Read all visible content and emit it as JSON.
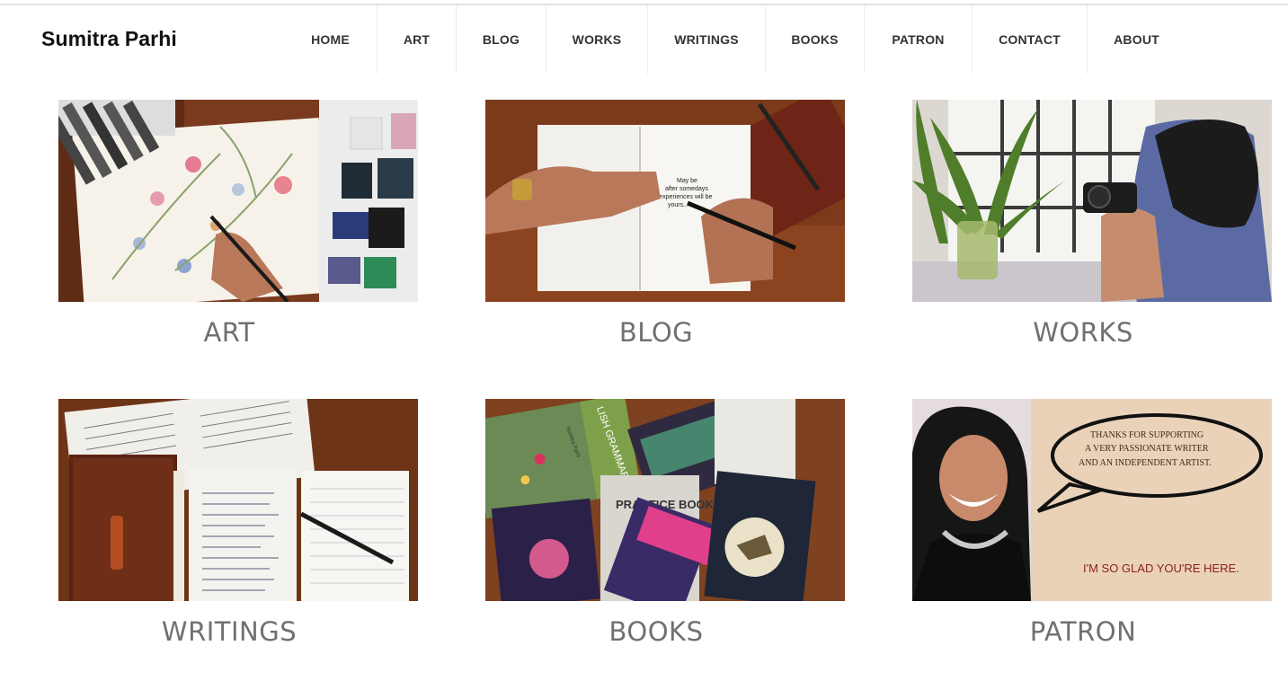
{
  "site": {
    "brand": "Sumitra Parhi"
  },
  "nav": {
    "items": [
      {
        "label": "HOME"
      },
      {
        "label": "ART"
      },
      {
        "label": "BLOG"
      },
      {
        "label": "WORKS"
      },
      {
        "label": "WRITINGS"
      },
      {
        "label": "BOOKS"
      },
      {
        "label": "PATRON"
      },
      {
        "label": "CONTACT"
      },
      {
        "label": "ABOUT"
      }
    ]
  },
  "cards": [
    {
      "title": "ART"
    },
    {
      "title": "BLOG",
      "image_text": [
        "May be",
        "after somedays",
        "my experiences will be",
        "yours..."
      ]
    },
    {
      "title": "WORKS"
    },
    {
      "title": "WRITINGS"
    },
    {
      "title": "BOOKS",
      "image_text": [
        "PRACTICE BOOK",
        "LISH GRAMMAR",
        "Sumitra Parhi"
      ]
    },
    {
      "title": "PATRON",
      "image_text": [
        "THANKS FOR SUPPORTING",
        "A VERY  PASSIONATE WRITER",
        "AND AN INDEPENDENT ARTIST.",
        "I'M SO GLAD YOU'RE HERE."
      ]
    }
  ],
  "colors": {
    "caption": "#707070",
    "patron_accent": "#8b1e1e",
    "wood": "#6b3318"
  }
}
